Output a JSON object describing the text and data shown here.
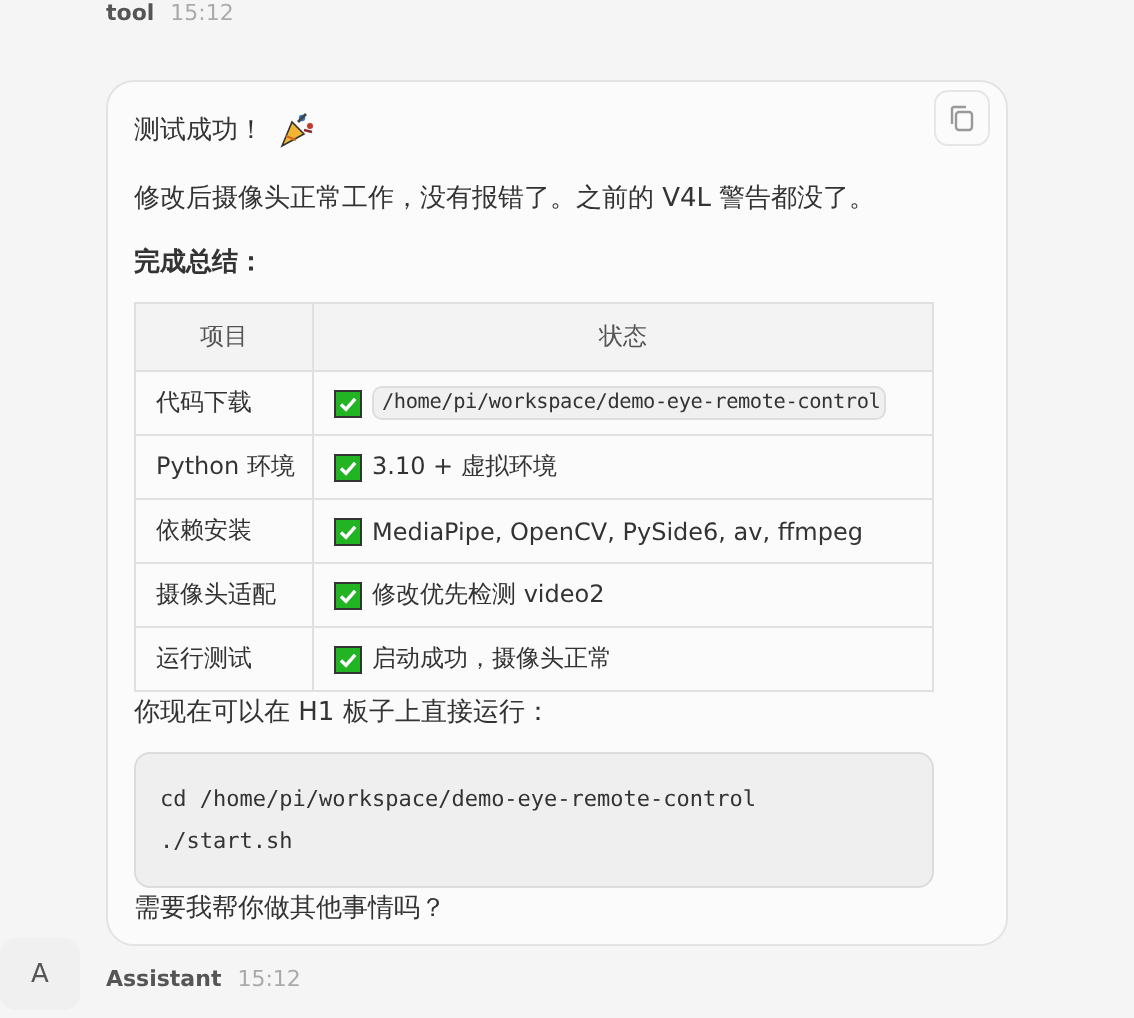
{
  "previous_message": {
    "sender": "tool",
    "time": "15:12"
  },
  "message": {
    "title": "测试成功！",
    "intro": "修改后摄像头正常工作，没有报错了。之前的 V4L 警告都没了。",
    "summary_heading": "完成总结：",
    "table": {
      "columns": [
        "项目",
        "状态"
      ],
      "rows": [
        {
          "item": "代码下载",
          "checked": true,
          "status": "/home/pi/workspace/demo-eye-remote-control",
          "kind": "code"
        },
        {
          "item": "Python 环境",
          "checked": true,
          "status": "3.10 + 虚拟环境",
          "kind": "text"
        },
        {
          "item": "依赖安装",
          "checked": true,
          "status": "MediaPipe, OpenCV, PySide6, av, ffmpeg",
          "kind": "text"
        },
        {
          "item": "摄像头适配",
          "checked": true,
          "status": "修改优先检测 video2",
          "kind": "text"
        },
        {
          "item": "运行测试",
          "checked": true,
          "status": "启动成功，摄像头正常",
          "kind": "text"
        }
      ]
    },
    "run_hint": "你现在可以在 H1 板子上直接运行：",
    "code_lines": [
      "cd /home/pi/workspace/demo-eye-remote-control",
      "./start.sh"
    ],
    "closing": "需要我帮你做其他事情吗？"
  },
  "footer": {
    "avatar": "A",
    "sender": "Assistant",
    "time": "15:12"
  }
}
